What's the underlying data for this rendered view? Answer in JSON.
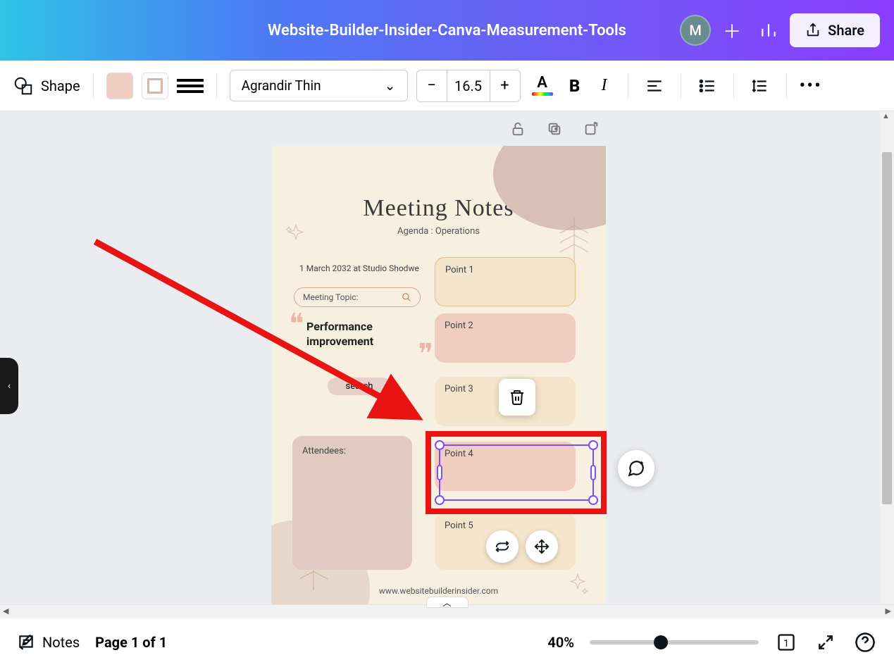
{
  "header": {
    "doc_title": "Website-Builder-Insider-Canva-Measurement-Tools",
    "avatar_initial": "M",
    "share_label": "Share"
  },
  "toolbar": {
    "shape_label": "Shape",
    "font_name": "Agrandir Thin",
    "font_size": "16.5",
    "text_color_letter": "A",
    "bold": "B",
    "italic": "I",
    "more": "•••"
  },
  "design": {
    "title": "Meeting Notes",
    "subtitle": "Agenda : Operations",
    "date_line": "1 March 2032 at Studio Shodwe",
    "meeting_topic_label": "Meeting Topic:",
    "quote_line1": "Performance",
    "quote_line2": "improvement",
    "search_pill": "search",
    "attendees_label": "Attendees:",
    "points": {
      "p1": "Point 1",
      "p2": "Point 2",
      "p3": "Point 3",
      "p4": "Point 4",
      "p5": "Point 5"
    },
    "footer_url": "www.websitebuilderinsider.com"
  },
  "bottom": {
    "notes_label": "Notes",
    "page_label": "Page 1 of 1",
    "zoom_label": "40%",
    "page_badge": "1"
  }
}
